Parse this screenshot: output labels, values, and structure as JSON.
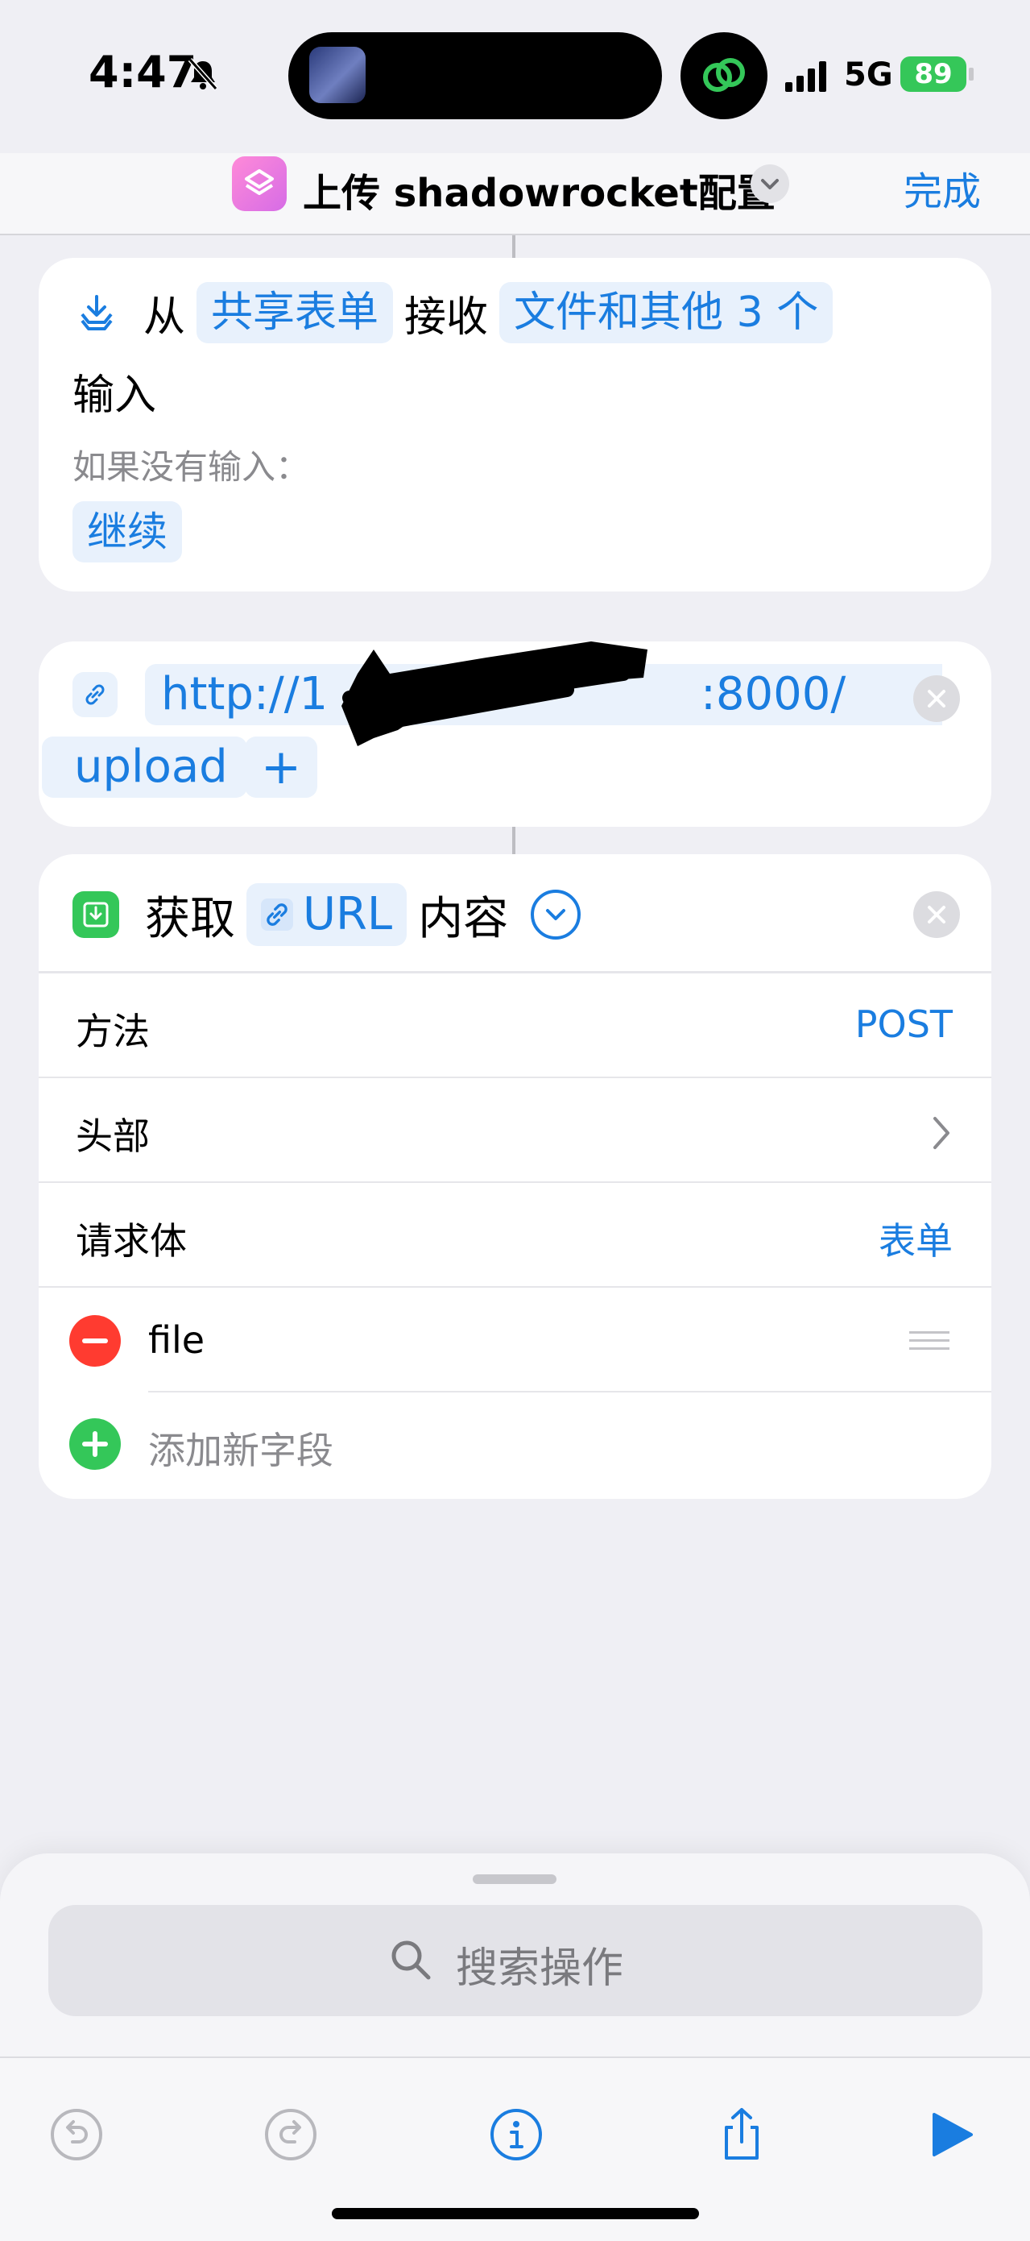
{
  "status_bar": {
    "time": "4:47",
    "network": "5G",
    "battery": "89"
  },
  "nav": {
    "title": "上传 shadowrocket配置",
    "done": "完成"
  },
  "receive_card": {
    "from": "从",
    "source": "共享表单",
    "receive": "接收",
    "types": "文件和其他 3 个",
    "input_word": "输入",
    "hint": "如果没有输入：",
    "fallback": "继续"
  },
  "url_card": {
    "url_line1": "http://1                          :8000/",
    "url_line2": "upload",
    "add": "+"
  },
  "get_card": {
    "verb": "获取",
    "variable": "URL",
    "suffix": "内容",
    "rows": [
      {
        "label": "方法",
        "value": "POST"
      },
      {
        "label": "头部",
        "value": ""
      },
      {
        "label": "请求体",
        "value": "表单"
      }
    ],
    "field": "file",
    "add_field": "添加新字段"
  },
  "sheet": {
    "search_placeholder": "搜索操作"
  },
  "colors": {
    "accent": "#1a7de0",
    "green": "#34c759",
    "red": "#ff3b30"
  }
}
